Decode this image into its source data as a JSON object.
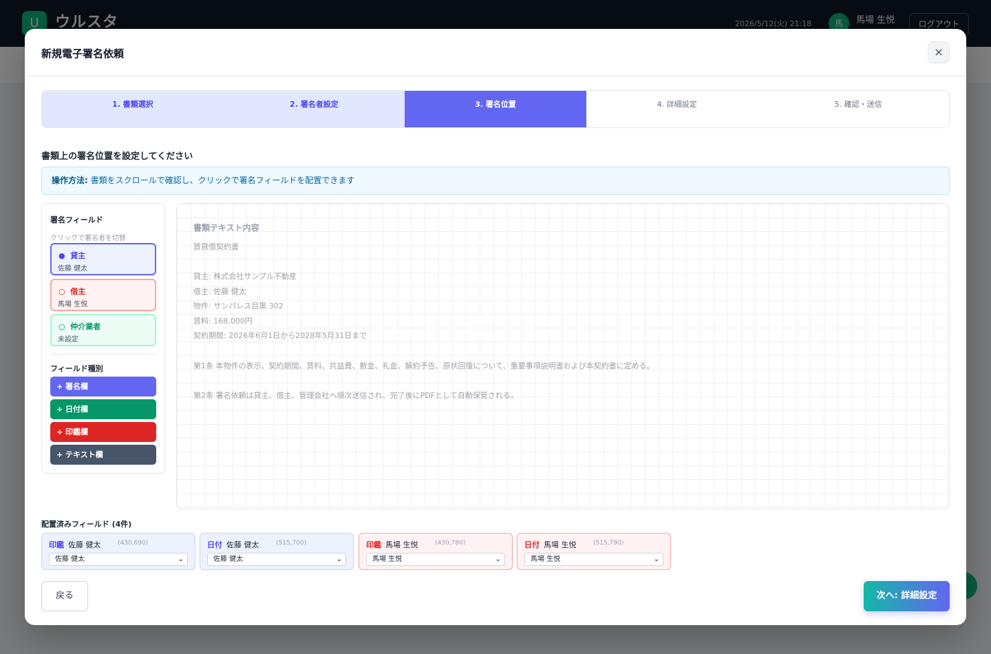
{
  "app": {
    "logo_letter": "U",
    "name": "ウルスタ",
    "datetime": "2026/5/12(火) 21:18",
    "avatar_initial": "馬",
    "username": "馬場 生悦",
    "logout_label": "ログアウト"
  },
  "modal": {
    "title": "新規電子署名依頼",
    "close_icon": "×",
    "steps": [
      {
        "label": "1. 書類選択",
        "state": "done"
      },
      {
        "label": "2. 署名者設定",
        "state": "done"
      },
      {
        "label": "3. 署名位置",
        "state": "active"
      },
      {
        "label": "4. 詳細設定",
        "state": "todo"
      },
      {
        "label": "5. 確認・送信",
        "state": "todo"
      }
    ],
    "section_title": "書類上の署名位置を設定してください",
    "info": {
      "label": "操作方法:",
      "text": "書類をスクロールで確認し、クリックで署名フィールドを配置できます"
    },
    "fields_panel": {
      "title": "署名フィールド",
      "hint": "クリックで署名者を切替",
      "signers": [
        {
          "bullet": "●",
          "role": "貸主",
          "name": "佐藤 健太"
        },
        {
          "bullet": "○",
          "role": "借主",
          "name": "馬場 生悦"
        },
        {
          "bullet": "○",
          "role": "仲介業者",
          "name": "未設定"
        }
      ],
      "types_title": "フィールド種別",
      "types": [
        "+ 署名欄",
        "+ 日付欄",
        "+ 印鑑欄",
        "+ テキスト欄"
      ]
    },
    "document": {
      "heading": "書類テキスト内容",
      "lines": [
        "賃貸借契約書",
        "貸主: 株式会社サンプル不動産",
        "借主: 佐藤 健太",
        "物件: サンパレス目黒 302",
        "賃料: 168,000円",
        "契約期間: 2026年6月1日から2028年5月31日まで",
        "第1条 本物件の表示、契約期間、賃料、共益費、敷金、礼金、解約予告、原状回復について、重要事項説明書および本契約書に定める。",
        "第2条 署名依頼は貸主、借主、管理会社へ順次送信され、完了後にPDFとして自動保管される。"
      ]
    },
    "placed": {
      "title": "配置済みフィールド (4件)",
      "items": [
        {
          "type": "印鑑",
          "name": "佐藤 健太",
          "coords": "(430,690)",
          "selected": "佐藤 健太",
          "color": "blue"
        },
        {
          "type": "日付",
          "name": "佐藤 健太",
          "coords": "(515,700)",
          "selected": "佐藤 健太",
          "color": "blue"
        },
        {
          "type": "印鑑",
          "name": "馬場 生悦",
          "coords": "(430,780)",
          "selected": "馬場 生悦",
          "color": "red"
        },
        {
          "type": "日付",
          "name": "馬場 生悦",
          "coords": "(515,790)",
          "selected": "馬場 生悦",
          "color": "red"
        }
      ]
    },
    "back_label": "戻る",
    "next_label": "次へ: 詳細設定"
  },
  "colors": {
    "accent": "#6366f1",
    "success": "#059669",
    "danger": "#dc2626",
    "slate": "#475569",
    "header_bg": "#111827"
  },
  "icons": {
    "close": "close-icon",
    "dropdown": "chevron-down-icon"
  }
}
